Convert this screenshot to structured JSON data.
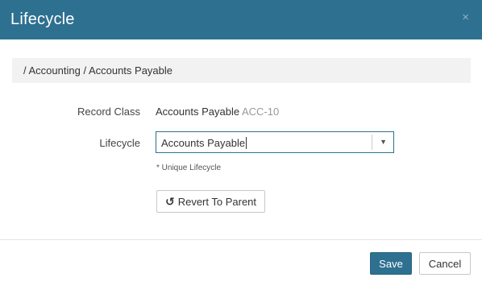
{
  "dialog": {
    "title": "Lifecycle",
    "close_glyph": "×"
  },
  "breadcrumb": "/ Accounting / Accounts Payable",
  "form": {
    "record_class_label": "Record Class",
    "record_class_name": "Accounts Payable",
    "record_class_code": "ACC-10",
    "lifecycle_label": "Lifecycle",
    "lifecycle_value": "Accounts Payable",
    "hint": "* Unique Lifecycle",
    "revert_label": "Revert To Parent",
    "revert_icon": "undo-icon"
  },
  "footer": {
    "save_label": "Save",
    "cancel_label": "Cancel"
  },
  "colors": {
    "header": "#2e7090",
    "primary_button": "#2e7090",
    "breadcrumb_bg": "#f2f2f2"
  }
}
